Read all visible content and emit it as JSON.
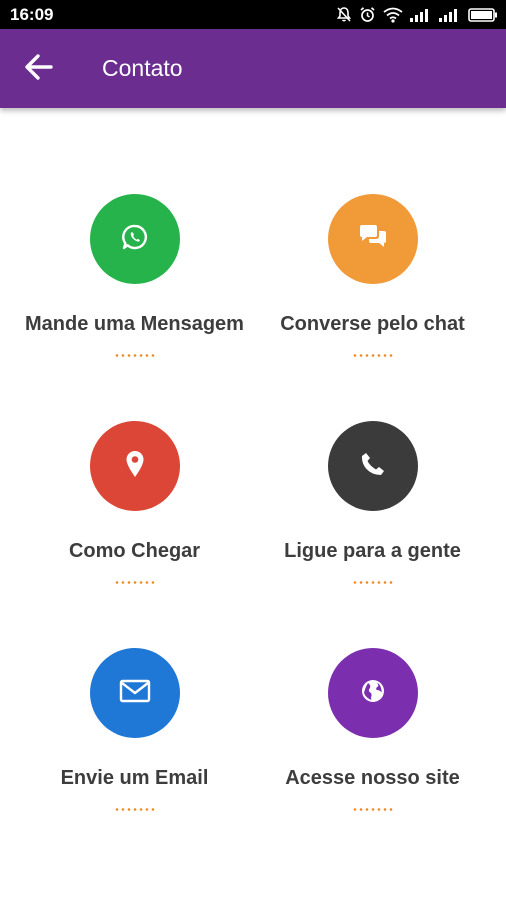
{
  "status_bar": {
    "time": "16:09",
    "icons": [
      "bell-off-icon",
      "alarm-icon",
      "wifi-icon",
      "signal-icon",
      "signal-icon",
      "battery-icon"
    ]
  },
  "app_bar": {
    "title": "Contato",
    "back_icon": "arrow-left-icon",
    "color": "#6c2d91"
  },
  "contacts": [
    {
      "label": "Mande uma Mensagem",
      "icon": "whatsapp-icon",
      "color": "#27b34b"
    },
    {
      "label": "Converse pelo chat",
      "icon": "chat-bubbles-icon",
      "color": "#f09a38"
    },
    {
      "label": "Como Chegar",
      "icon": "map-pin-icon",
      "color": "#dc4637"
    },
    {
      "label": "Ligue para a gente",
      "icon": "phone-icon",
      "color": "#3b3b3b"
    },
    {
      "label": "Envie um Email",
      "icon": "envelope-icon",
      "color": "#1f77d6"
    },
    {
      "label": "Acesse nosso site",
      "icon": "globe-icon",
      "color": "#7b2fae"
    }
  ],
  "accent_dots_color": "#f08a24"
}
